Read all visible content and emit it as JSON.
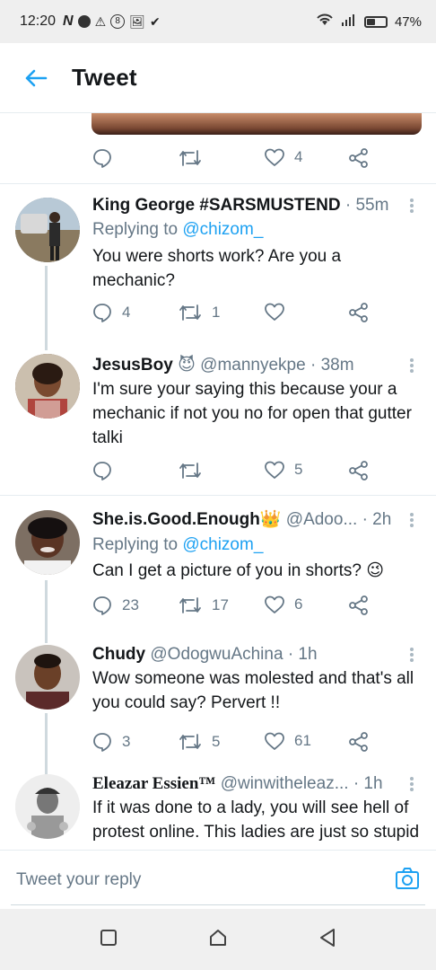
{
  "status_bar": {
    "time": "12:20",
    "battery": "47%",
    "battery_level": 0.47
  },
  "header": {
    "title": "Tweet"
  },
  "top_actions": {
    "likes": "4"
  },
  "tweets": [
    {
      "name": "King George #SARSMUSTEND",
      "handle": "",
      "time": "· 55m",
      "replying_label": "Replying to",
      "replying_handle": "@chizom_",
      "text": "You were shorts work? Are you a mechanic?",
      "replies": "4",
      "retweets": "1",
      "likes": ""
    },
    {
      "name": "JesusBoy",
      "emoji": "😈",
      "handle": "@mannyekpe",
      "time": "· 38m",
      "text": "I'm sure your saying this because your a mechanic if not you no for open that gutter talki",
      "replies": "",
      "retweets": "",
      "likes": "5"
    },
    {
      "name": "She.is.Good.Enough",
      "emoji": "👑",
      "handle": "@Adoo...",
      "time": "· 2h",
      "replying_label": "Replying to",
      "replying_handle": "@chizom_",
      "text": "Can I get a picture of you in shorts? 😉",
      "replies": "23",
      "retweets": "17",
      "likes": "6"
    },
    {
      "name": "Chudy",
      "handle": "@OdogwuAchina",
      "time": "· 1h",
      "text": "Wow someone was molested and that's all you could say? Pervert !!",
      "replies": "3",
      "retweets": "5",
      "likes": "61"
    },
    {
      "name": "Eleazar Essien™",
      "handle": "@winwitheleaz...",
      "time": "· 1h",
      "text": "If it was done to a lady, you will see hell of protest online. This ladies are just so stupid",
      "replies": "",
      "retweets": "",
      "likes": ""
    }
  ],
  "composer": {
    "placeholder": "Tweet your reply"
  },
  "colors": {
    "accent": "#1da1f2",
    "secondary_text": "#657786",
    "divider": "#e6ecf0"
  },
  "icons": [
    "back-arrow-icon",
    "reply-icon",
    "retweet-icon",
    "like-icon",
    "share-icon",
    "more-icon",
    "camera-icon",
    "square-nav-icon",
    "home-nav-icon",
    "back-nav-icon"
  ]
}
